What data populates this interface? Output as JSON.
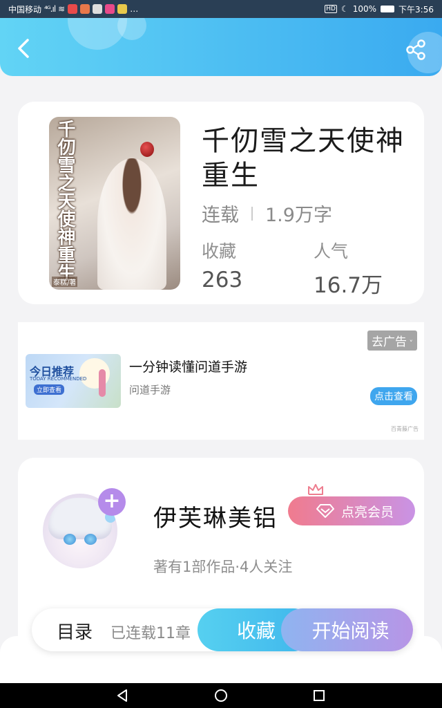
{
  "status_bar": {
    "carrier": "中国移动",
    "signal": "⁴ᴳ.ıl",
    "battery": "100%",
    "time": "下午3:56"
  },
  "header": {
    "back_icon": "chevron-left-icon",
    "share_icon": "share-icon"
  },
  "book": {
    "title": "千仞雪之天使神重生",
    "cover_title": "千仞雪之天使神重生",
    "cover_author": "泰糕/著",
    "status": "连载",
    "word_count": "1.9万字",
    "favorites_label": "收藏",
    "favorites_value": "263",
    "popularity_label": "人气",
    "popularity_value": "16.7万"
  },
  "ad": {
    "remove_label": "去广告",
    "thumb_title": "今日推荐",
    "thumb_sub": "TODAY RECOMMENDED",
    "thumb_button": "立即查看",
    "title": "一分钟读懂问道手游",
    "subtitle": "问道手游",
    "cta": "点击查看",
    "source": "百青藤广告"
  },
  "author": {
    "name": "伊芙琳美铝",
    "vip_label": "点亮会员",
    "stats": "著有1部作品·4人关注"
  },
  "action_bar": {
    "toc_label": "目录",
    "toc_count": "已连载11章",
    "collect_label": "收藏",
    "read_label": "开始阅读"
  },
  "colors": {
    "header_start": "#62d4f5",
    "header_end": "#3aaaf0",
    "vip_start": "#f07b8e",
    "vip_end": "#c993e5"
  }
}
